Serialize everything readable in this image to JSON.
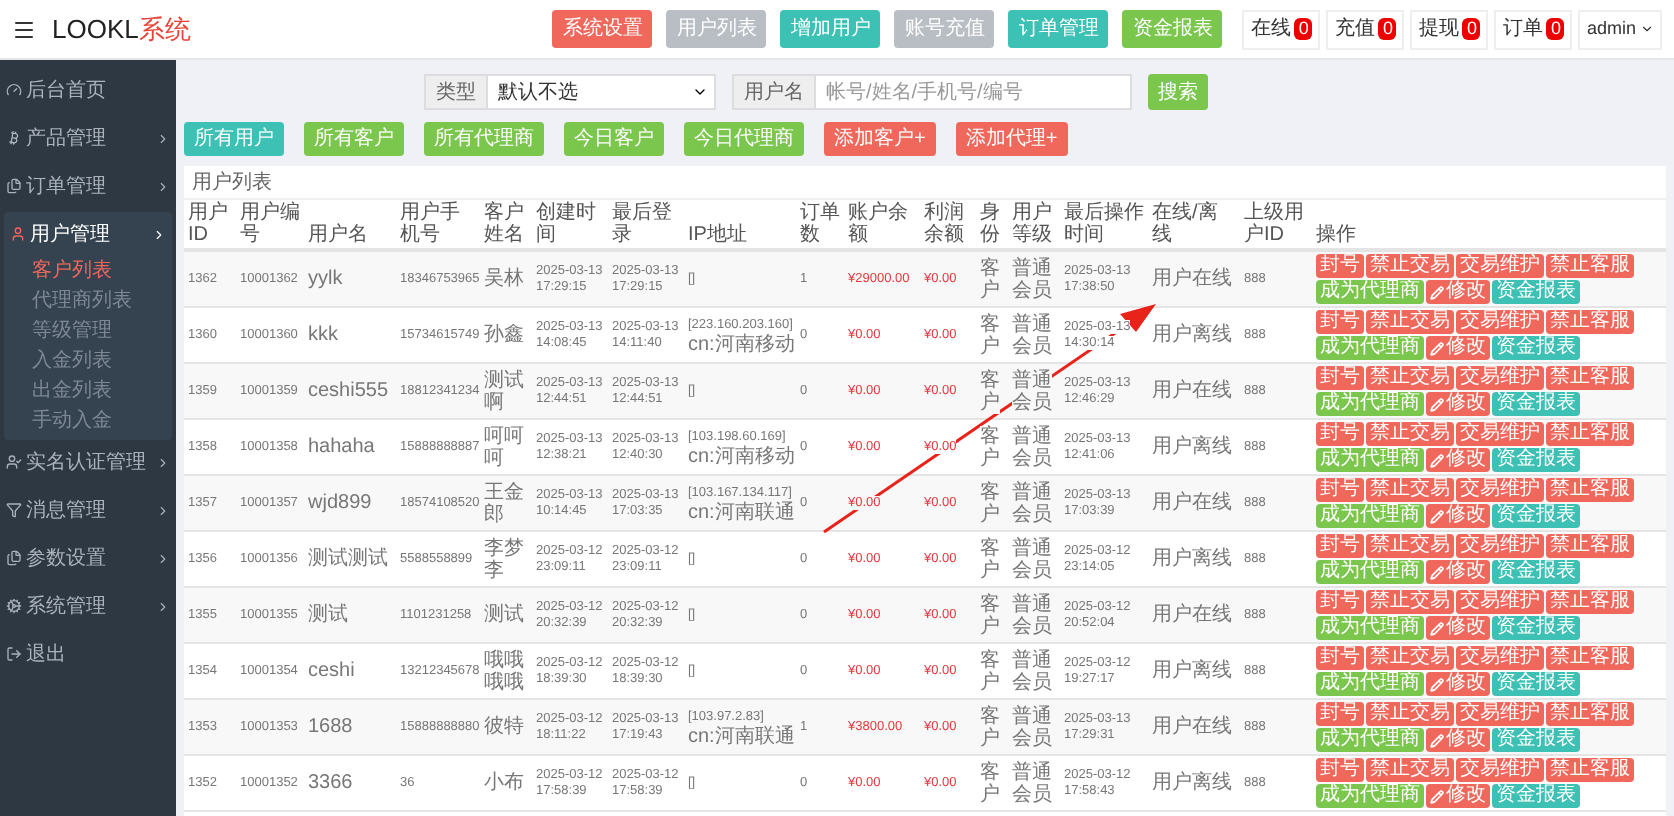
{
  "header": {
    "logo_text": "LOOKL",
    "logo_accent": "系统",
    "nav_buttons": [
      {
        "label": "系统设置",
        "kind": "danger"
      },
      {
        "label": "用户列表",
        "kind": "default"
      },
      {
        "label": "增加用户",
        "kind": "info"
      },
      {
        "label": "账号充值",
        "kind": "default"
      },
      {
        "label": "订单管理",
        "kind": "info"
      },
      {
        "label": "资金报表",
        "kind": "success"
      }
    ],
    "counters": [
      {
        "label": "在线",
        "count": "0"
      },
      {
        "label": "充值",
        "count": "0"
      },
      {
        "label": "提现",
        "count": "0"
      },
      {
        "label": "订单",
        "count": "0"
      }
    ],
    "user": "admin"
  },
  "sidebar": {
    "items": [
      {
        "label": "后台首页",
        "kind": "link"
      },
      {
        "label": "产品管理",
        "kind": "group",
        "expanded": false
      },
      {
        "label": "订单管理",
        "kind": "group",
        "expanded": false
      },
      {
        "label": "用户管理",
        "kind": "group",
        "expanded": true,
        "children": [
          {
            "label": "客户列表",
            "selected": true
          },
          {
            "label": "代理商列表",
            "selected": false
          },
          {
            "label": "等级管理",
            "selected": false
          },
          {
            "label": "入金列表",
            "selected": false
          },
          {
            "label": "出金列表",
            "selected": false
          },
          {
            "label": "手动入金",
            "selected": false
          }
        ]
      },
      {
        "label": "实名认证管理",
        "kind": "group",
        "expanded": false
      },
      {
        "label": "消息管理",
        "kind": "group",
        "expanded": false
      },
      {
        "label": "参数设置",
        "kind": "group",
        "expanded": false
      },
      {
        "label": "系统管理",
        "kind": "group",
        "expanded": false
      },
      {
        "label": "退出",
        "kind": "link"
      }
    ]
  },
  "filter": {
    "type_label": "类型",
    "type_value": "默认不选",
    "search_label": "用户名",
    "search_placeholder": "帐号/姓名/手机号/编号",
    "search_button": "搜索"
  },
  "quick_buttons": [
    {
      "label": "所有用户",
      "kind": "info"
    },
    {
      "label": "所有客户",
      "kind": "success"
    },
    {
      "label": "所有代理商",
      "kind": "success"
    },
    {
      "label": "今日客户",
      "kind": "success"
    },
    {
      "label": "今日代理商",
      "kind": "success"
    },
    {
      "label": "添加客户+",
      "kind": "danger"
    },
    {
      "label": "添加代理+",
      "kind": "danger"
    }
  ],
  "table": {
    "title": "用户列表",
    "columns": [
      "用户ID",
      "用户编号",
      "用户名",
      "用户手机号",
      "客户姓名",
      "创建时间",
      "最后登录",
      "IP地址",
      "订单数",
      "账户余额",
      "利润余额",
      "身份",
      "用户等级",
      "最后操作时间",
      "在线/离线",
      "上级用户ID",
      "操作"
    ],
    "rows": [
      {
        "id": "1362",
        "number": "10001362",
        "username": "yylk",
        "phone": "18346753965",
        "name": "吴林",
        "created": "2025-03-13 17:29:15",
        "last_login": "2025-03-13 17:29:15",
        "ip": [
          "[]"
        ],
        "orders": "1",
        "balance": "¥29000.00",
        "profit": "¥0.00",
        "identity": "客户",
        "level": "普通会员",
        "last_action": "2025-03-13 17:38:50",
        "online": "用户在线",
        "parent_id": "888",
        "actions": [
          {
            "label": "封号",
            "kind": "danger"
          },
          {
            "label": "禁止交易",
            "kind": "danger"
          },
          {
            "label": "交易维护",
            "kind": "danger"
          },
          {
            "label": "禁止客服",
            "kind": "danger"
          },
          {
            "label": "成为代理商",
            "kind": "success"
          },
          {
            "label": "修改",
            "kind": "edit"
          },
          {
            "label": "资金报表",
            "kind": "info"
          }
        ]
      },
      {
        "id": "1360",
        "number": "10001360",
        "username": "kkk",
        "phone": "15734615749",
        "name": "孙鑫",
        "created": "2025-03-13 14:08:45",
        "last_login": "2025-03-13 14:11:40",
        "ip": [
          "[223.160.203.160]",
          "cn:河南移动"
        ],
        "orders": "0",
        "balance": "¥0.00",
        "profit": "¥0.00",
        "identity": "客户",
        "level": "普通会员",
        "last_action": "2025-03-13 14:30:14",
        "online": "用户离线",
        "parent_id": "888",
        "actions": [
          {
            "label": "封号",
            "kind": "danger"
          },
          {
            "label": "禁止交易",
            "kind": "danger"
          },
          {
            "label": "交易维护",
            "kind": "danger"
          },
          {
            "label": "禁止客服",
            "kind": "danger"
          },
          {
            "label": "成为代理商",
            "kind": "success"
          },
          {
            "label": "修改",
            "kind": "edit"
          },
          {
            "label": "资金报表",
            "kind": "info"
          }
        ]
      },
      {
        "id": "1359",
        "number": "10001359",
        "username": "ceshi555",
        "phone": "18812341234",
        "name": "测试啊",
        "created": "2025-03-13 12:44:51",
        "last_login": "2025-03-13 12:44:51",
        "ip": [
          "[]"
        ],
        "orders": "0",
        "balance": "¥0.00",
        "profit": "¥0.00",
        "identity": "客户",
        "level": "普通会员",
        "last_action": "2025-03-13 12:46:29",
        "online": "用户在线",
        "parent_id": "888",
        "actions": [
          {
            "label": "封号",
            "kind": "danger"
          },
          {
            "label": "禁止交易",
            "kind": "danger"
          },
          {
            "label": "交易维护",
            "kind": "danger"
          },
          {
            "label": "禁止客服",
            "kind": "danger"
          },
          {
            "label": "成为代理商",
            "kind": "success"
          },
          {
            "label": "修改",
            "kind": "edit"
          },
          {
            "label": "资金报表",
            "kind": "info"
          }
        ]
      },
      {
        "id": "1358",
        "number": "10001358",
        "username": "hahaha",
        "phone": "15888888887",
        "name": "呵呵呵",
        "created": "2025-03-13 12:38:21",
        "last_login": "2025-03-13 12:40:30",
        "ip": [
          "[103.198.60.169]",
          "cn:河南移动"
        ],
        "orders": "0",
        "balance": "¥0.00",
        "profit": "¥0.00",
        "identity": "客户",
        "level": "普通会员",
        "last_action": "2025-03-13 12:41:06",
        "online": "用户离线",
        "parent_id": "888",
        "actions": [
          {
            "label": "封号",
            "kind": "danger"
          },
          {
            "label": "禁止交易",
            "kind": "danger"
          },
          {
            "label": "交易维护",
            "kind": "danger"
          },
          {
            "label": "禁止客服",
            "kind": "danger"
          },
          {
            "label": "成为代理商",
            "kind": "success"
          },
          {
            "label": "修改",
            "kind": "edit"
          },
          {
            "label": "资金报表",
            "kind": "info"
          }
        ]
      },
      {
        "id": "1357",
        "number": "10001357",
        "username": "wjd899",
        "phone": "18574108520",
        "name": "王金郎",
        "created": "2025-03-13 10:14:45",
        "last_login": "2025-03-13 17:03:35",
        "ip": [
          "[103.167.134.117]",
          "cn:河南联通"
        ],
        "orders": "0",
        "balance": "¥0.00",
        "profit": "¥0.00",
        "identity": "客户",
        "level": "普通会员",
        "last_action": "2025-03-13 17:03:39",
        "online": "用户在线",
        "parent_id": "888",
        "actions": [
          {
            "label": "封号",
            "kind": "danger"
          },
          {
            "label": "禁止交易",
            "kind": "danger"
          },
          {
            "label": "交易维护",
            "kind": "danger"
          },
          {
            "label": "禁止客服",
            "kind": "danger"
          },
          {
            "label": "成为代理商",
            "kind": "success"
          },
          {
            "label": "修改",
            "kind": "edit"
          },
          {
            "label": "资金报表",
            "kind": "info"
          }
        ]
      },
      {
        "id": "1356",
        "number": "10001356",
        "username": "测试测试",
        "phone": "5588558899",
        "name": "李梦李",
        "created": "2025-03-12 23:09:11",
        "last_login": "2025-03-12 23:09:11",
        "ip": [
          "[]"
        ],
        "orders": "0",
        "balance": "¥0.00",
        "profit": "¥0.00",
        "identity": "客户",
        "level": "普通会员",
        "last_action": "2025-03-12 23:14:05",
        "online": "用户离线",
        "parent_id": "888",
        "actions": [
          {
            "label": "封号",
            "kind": "danger"
          },
          {
            "label": "禁止交易",
            "kind": "danger"
          },
          {
            "label": "交易维护",
            "kind": "danger"
          },
          {
            "label": "禁止客服",
            "kind": "danger"
          },
          {
            "label": "成为代理商",
            "kind": "success"
          },
          {
            "label": "修改",
            "kind": "edit"
          },
          {
            "label": "资金报表",
            "kind": "info"
          }
        ]
      },
      {
        "id": "1355",
        "number": "10001355",
        "username": "测试",
        "phone": "1101231258",
        "name": "测试",
        "created": "2025-03-12 20:32:39",
        "last_login": "2025-03-12 20:32:39",
        "ip": [
          "[]"
        ],
        "orders": "0",
        "balance": "¥0.00",
        "profit": "¥0.00",
        "identity": "客户",
        "level": "普通会员",
        "last_action": "2025-03-12 20:52:04",
        "online": "用户在线",
        "parent_id": "888",
        "actions": [
          {
            "label": "封号",
            "kind": "danger"
          },
          {
            "label": "禁止交易",
            "kind": "danger"
          },
          {
            "label": "交易维护",
            "kind": "danger"
          },
          {
            "label": "禁止客服",
            "kind": "danger"
          },
          {
            "label": "成为代理商",
            "kind": "success"
          },
          {
            "label": "修改",
            "kind": "edit"
          },
          {
            "label": "资金报表",
            "kind": "info"
          }
        ]
      },
      {
        "id": "1354",
        "number": "10001354",
        "username": "ceshi",
        "phone": "13212345678",
        "name": "哦哦哦哦",
        "created": "2025-03-12 18:39:30",
        "last_login": "2025-03-12 18:39:30",
        "ip": [
          "[]"
        ],
        "orders": "0",
        "balance": "¥0.00",
        "profit": "¥0.00",
        "identity": "客户",
        "level": "普通会员",
        "last_action": "2025-03-12 19:27:17",
        "online": "用户离线",
        "parent_id": "888",
        "actions": [
          {
            "label": "封号",
            "kind": "danger"
          },
          {
            "label": "禁止交易",
            "kind": "danger"
          },
          {
            "label": "交易维护",
            "kind": "danger"
          },
          {
            "label": "禁止客服",
            "kind": "danger"
          },
          {
            "label": "成为代理商",
            "kind": "success"
          },
          {
            "label": "修改",
            "kind": "edit"
          },
          {
            "label": "资金报表",
            "kind": "info"
          }
        ]
      },
      {
        "id": "1353",
        "number": "10001353",
        "username": "1688",
        "phone": "15888888880",
        "name": "彼特",
        "created": "2025-03-12 18:11:22",
        "last_login": "2025-03-13 17:19:43",
        "ip": [
          "[103.97.2.83]",
          "cn:河南联通"
        ],
        "orders": "1",
        "balance": "¥3800.00",
        "profit": "¥0.00",
        "identity": "客户",
        "level": "普通会员",
        "last_action": "2025-03-13 17:29:31",
        "online": "用户在线",
        "parent_id": "888",
        "actions": [
          {
            "label": "封号",
            "kind": "danger"
          },
          {
            "label": "禁止交易",
            "kind": "danger"
          },
          {
            "label": "交易维护",
            "kind": "danger"
          },
          {
            "label": "禁止客服",
            "kind": "danger"
          },
          {
            "label": "成为代理商",
            "kind": "success"
          },
          {
            "label": "修改",
            "kind": "edit"
          },
          {
            "label": "资金报表",
            "kind": "info"
          }
        ]
      },
      {
        "id": "1352",
        "number": "10001352",
        "username": "3366",
        "phone": "36",
        "name": "小布",
        "created": "2025-03-12 17:58:39",
        "last_login": "2025-03-12 17:58:39",
        "ip": [
          "[]"
        ],
        "orders": "0",
        "balance": "¥0.00",
        "profit": "¥0.00",
        "identity": "客户",
        "level": "普通会员",
        "last_action": "2025-03-12 17:58:43",
        "online": "用户离线",
        "parent_id": "888",
        "actions": [
          {
            "label": "封号",
            "kind": "danger"
          },
          {
            "label": "禁止交易",
            "kind": "danger"
          },
          {
            "label": "交易维护",
            "kind": "danger"
          },
          {
            "label": "禁止客服",
            "kind": "danger"
          },
          {
            "label": "成为代理商",
            "kind": "success"
          },
          {
            "label": "修改",
            "kind": "edit"
          },
          {
            "label": "资金报表",
            "kind": "info"
          }
        ]
      }
    ]
  }
}
